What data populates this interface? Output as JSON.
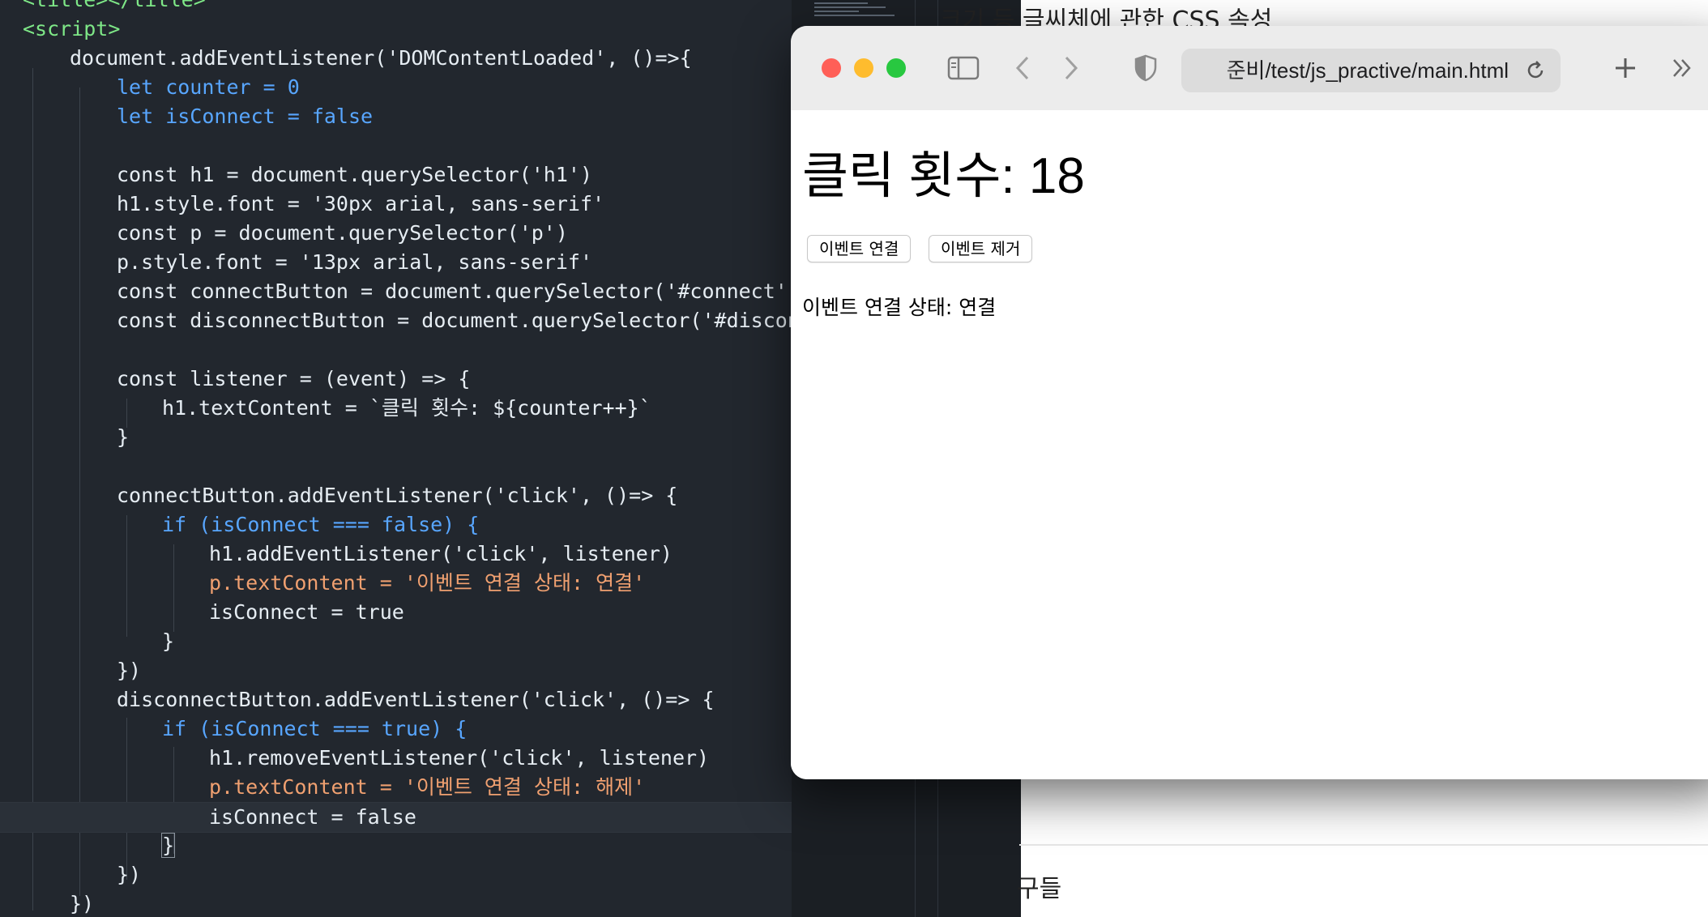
{
  "editor": {
    "lines": [
      "<title></title>",
      "<script>",
      "document.addEventListener('DOMContentLoaded', ()=>{",
      "let counter = 0",
      "let isConnect = false",
      "",
      "const h1 = document.querySelector('h1')",
      "h1.style.font = '30px arial, sans-serif'",
      "const p = document.querySelector('p')",
      "p.style.font = '13px arial, sans-serif'",
      "const connectButton = document.querySelector('#connect')",
      "const disconnectButton = document.querySelector('#disconne",
      "",
      "const listener = (event) => {",
      "h1.textContent = `클릭 횟수: ${counter++}`",
      "}",
      "",
      "connectButton.addEventListener('click', ()=> {",
      "if (isConnect === false) {",
      "h1.addEventListener('click', listener)",
      "p.textContent = '이벤트 연결 상태: 연결'",
      "isConnect = true",
      "}",
      "})",
      "disconnectButton.addEventListener('click', ()=> {",
      "if (isConnect === true) {",
      "h1.removeEventListener('click', listener)",
      "p.textContent = '이벤트 연결 상태: 해제'",
      "isConnect = false",
      "}",
      "})",
      "})"
    ]
  },
  "background_window": {
    "top_text": "크기 등 글씨체에 관한 CSS 속성",
    "bottom_text": "구들"
  },
  "browser": {
    "url": "준비/test/js_practive/main.html",
    "icons": {
      "sidebar": "sidebar-icon",
      "back": "chevron-left-icon",
      "forward": "chevron-right-icon",
      "privacy": "shield-icon",
      "reload": "reload-icon",
      "new_tab": "plus-icon",
      "more": "double-chevron-right-icon"
    },
    "page": {
      "heading": "클릭 횟수: 18",
      "connect_button": "이벤트 연결",
      "disconnect_button": "이벤트 제거",
      "status": "이벤트 연결 상태: 연결"
    }
  },
  "colors": {
    "editor_bg": "#22272e",
    "keyword": "#58a6ff",
    "string": "#f0a070",
    "traffic_red": "#ff5f57",
    "traffic_yellow": "#febc2e",
    "traffic_green": "#28c840"
  }
}
